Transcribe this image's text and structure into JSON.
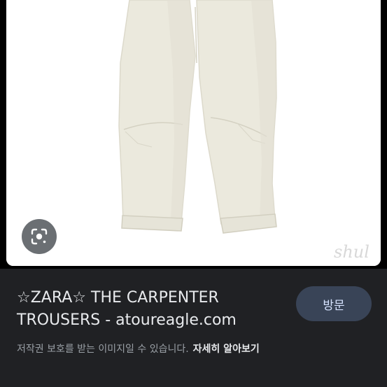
{
  "result": {
    "title": "☆ZARA☆ THE CARPENTER TROUSERS - atoureagle.com",
    "visit_label": "방문",
    "copyright_text": "저작권 보호를 받는 이미지일 수 있습니다.",
    "learn_more_label": "자세히 알아보기"
  },
  "image": {
    "watermark": "shul",
    "lens_icon": "google-lens-icon"
  },
  "colors": {
    "background": "#000000",
    "panel": "#202124",
    "visit_button_bg": "#394457",
    "visit_button_text": "#d6e3ff",
    "title_text": "#e8eaed",
    "secondary_text": "#9aa0a6"
  }
}
